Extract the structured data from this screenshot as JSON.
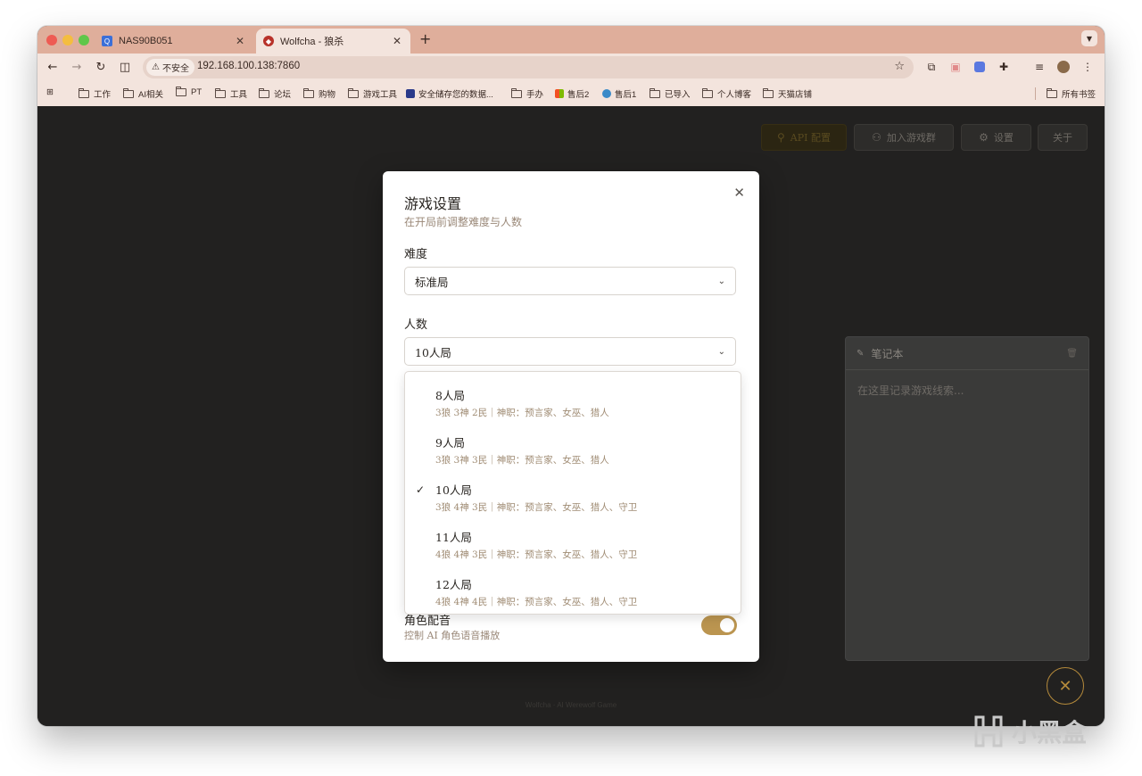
{
  "browser": {
    "tabs": [
      {
        "title": "NAS90B051",
        "active": false
      },
      {
        "title": "Wolfcha - 狼杀",
        "active": true
      }
    ],
    "new_tab": "+",
    "address": {
      "security_label": "不安全",
      "url": "192.168.100.138:7860"
    },
    "bookmarks": [
      {
        "label": "工作"
      },
      {
        "label": "AI相关"
      },
      {
        "label": "PT"
      },
      {
        "label": "工具"
      },
      {
        "label": "论坛"
      },
      {
        "label": "购物"
      },
      {
        "label": "游戏工具"
      },
      {
        "label": "安全储存您的数据..."
      },
      {
        "label": "手办"
      },
      {
        "label": "售后2"
      },
      {
        "label": "售后1"
      },
      {
        "label": "已导入"
      },
      {
        "label": "个人博客"
      },
      {
        "label": "天猫店铺"
      }
    ],
    "all_bookmarks": "所有书签"
  },
  "app": {
    "top_buttons": {
      "api": "API 配置",
      "join_group": "加入游戏群",
      "settings": "设置",
      "about": "关于"
    },
    "notebook": {
      "title": "笔记本",
      "placeholder": "在这里记录游戏线索..."
    },
    "footer": "Wolfcha · AI Werewolf Game"
  },
  "dialog": {
    "title": "游戏设置",
    "subtitle": "在开局前调整难度与人数",
    "difficulty_label": "难度",
    "difficulty_value": "标准局",
    "players_label": "人数",
    "players_value": "10人局",
    "options": [
      {
        "name": "8人局",
        "desc": "3狼 3神 2民｜神职：预言家、女巫、猎人",
        "selected": false
      },
      {
        "name": "9人局",
        "desc": "3狼 3神 3民｜神职：预言家、女巫、猎人",
        "selected": false
      },
      {
        "name": "10人局",
        "desc": "3狼 4神 3民｜神职：预言家、女巫、猎人、守卫",
        "selected": true
      },
      {
        "name": "11人局",
        "desc": "4狼 4神 3民｜神职：预言家、女巫、猎人、守卫",
        "selected": false
      },
      {
        "name": "12人局",
        "desc": "4狼 4神 4民｜神职：预言家、女巫、猎人、守卫",
        "selected": false
      }
    ],
    "voice_label": "角色配音",
    "voice_sub": "控制 AI 角色语音播放",
    "voice_enabled": true
  },
  "watermark": "小黑盒",
  "colors": {
    "tab_strip": "#dfae9b",
    "toolbar": "#f3e4dd",
    "page_bg": "#222120",
    "accent_gold": "#bb9550",
    "muted_brown": "#9a8878"
  }
}
